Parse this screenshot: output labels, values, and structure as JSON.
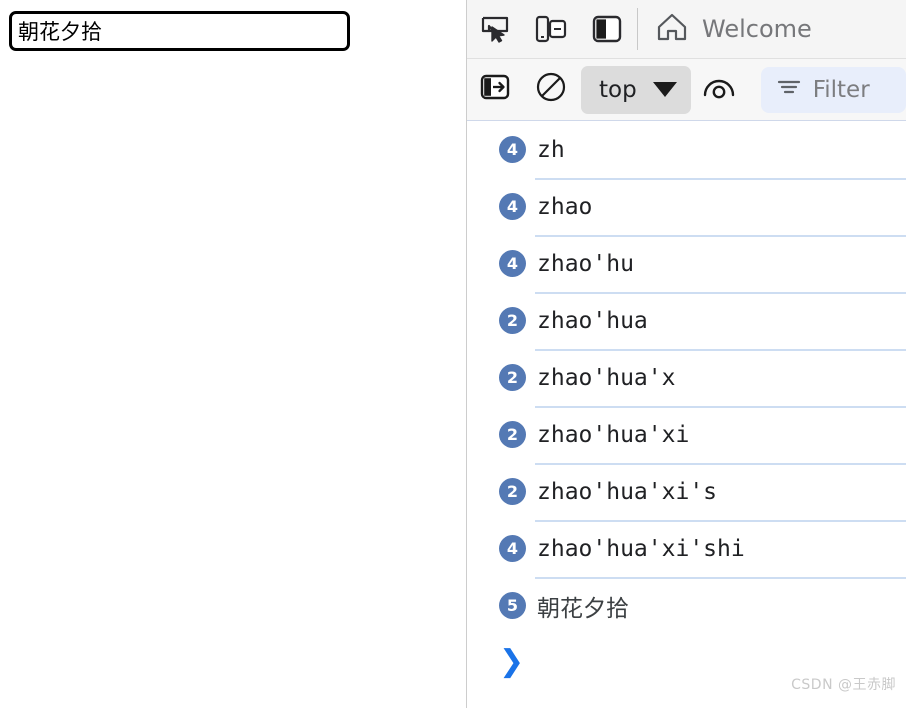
{
  "page": {
    "input": {
      "value": "朝花夕拾",
      "placeholder": ""
    }
  },
  "devtools": {
    "tabbar": {
      "inspect_icon": "inspect-element-icon",
      "device_toolbar_icon": "device-toolbar-icon",
      "dock_side_icon": "dock-side-icon",
      "tabs": [
        {
          "label": "Welcome",
          "icon": "home-icon",
          "active": true
        }
      ]
    },
    "console_toolbar": {
      "sidebar_icon": "console-sidebar-icon",
      "clear_icon": "clear-console-icon",
      "context": {
        "label": "top",
        "caret_icon": "chevron-down-icon"
      },
      "eye_icon": "live-expression-eye-icon",
      "filter": {
        "icon": "filter-icon",
        "placeholder": "Filter",
        "value": ""
      }
    },
    "messages": [
      {
        "count": "4",
        "text": "zh",
        "cjk": false
      },
      {
        "count": "4",
        "text": "zhao",
        "cjk": false
      },
      {
        "count": "4",
        "text": "zhao'hu",
        "cjk": false
      },
      {
        "count": "2",
        "text": "zhao'hua",
        "cjk": false
      },
      {
        "count": "2",
        "text": "zhao'hua'x",
        "cjk": false
      },
      {
        "count": "2",
        "text": "zhao'hua'xi",
        "cjk": false
      },
      {
        "count": "2",
        "text": "zhao'hua'xi's",
        "cjk": false
      },
      {
        "count": "4",
        "text": "zhao'hua'xi'shi",
        "cjk": false
      },
      {
        "count": "5",
        "text": "朝花夕拾",
        "cjk": true
      }
    ],
    "prompt": {
      "chevron": "❯"
    }
  },
  "watermark": {
    "text": "CSDN @王赤脚"
  },
  "colors": {
    "badge_blue": "#5479b4",
    "prompt_blue": "#1a73e8",
    "separator_blue": "#cdddf2",
    "filter_bg": "#e8eefb",
    "toolbar_bg": "#f5f5f5"
  }
}
